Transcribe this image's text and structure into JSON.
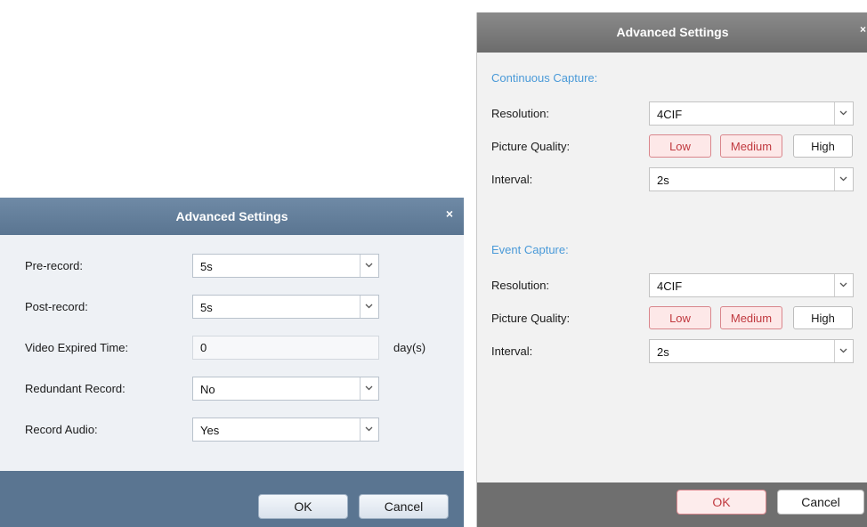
{
  "record_dialog": {
    "title": "Advanced Settings",
    "close_glyph": "×",
    "rows": [
      {
        "label": "Pre-record:",
        "value": "5s"
      },
      {
        "label": "Post-record:",
        "value": "5s"
      },
      {
        "label": "Video Expired Time:",
        "value": "0",
        "unit": "day(s)"
      },
      {
        "label": "Redundant Record:",
        "value": "No"
      },
      {
        "label": "Record Audio:",
        "value": "Yes"
      }
    ],
    "ok_label": "OK",
    "cancel_label": "Cancel"
  },
  "capture_dialog": {
    "title": "Advanced Settings",
    "close_glyph": "×",
    "continuous": {
      "section_title": "Continuous Capture:",
      "resolution_label": "Resolution:",
      "resolution_value": "4CIF",
      "quality_label": "Picture Quality:",
      "quality_options": [
        "Low",
        "Medium",
        "High"
      ],
      "interval_label": "Interval:",
      "interval_value": "2s"
    },
    "event": {
      "section_title": "Event Capture:",
      "resolution_label": "Resolution:",
      "resolution_value": "4CIF",
      "quality_label": "Picture Quality:",
      "quality_options": [
        "Low",
        "Medium",
        "High"
      ],
      "interval_label": "Interval:",
      "interval_value": "2s"
    },
    "ok_label": "OK",
    "cancel_label": "Cancel"
  },
  "colors": {
    "record_titlebar": "#5a7591",
    "capture_titlebar": "#6c6c6c",
    "section_title": "#4a9ad8",
    "accent_red": "#c0393f"
  }
}
